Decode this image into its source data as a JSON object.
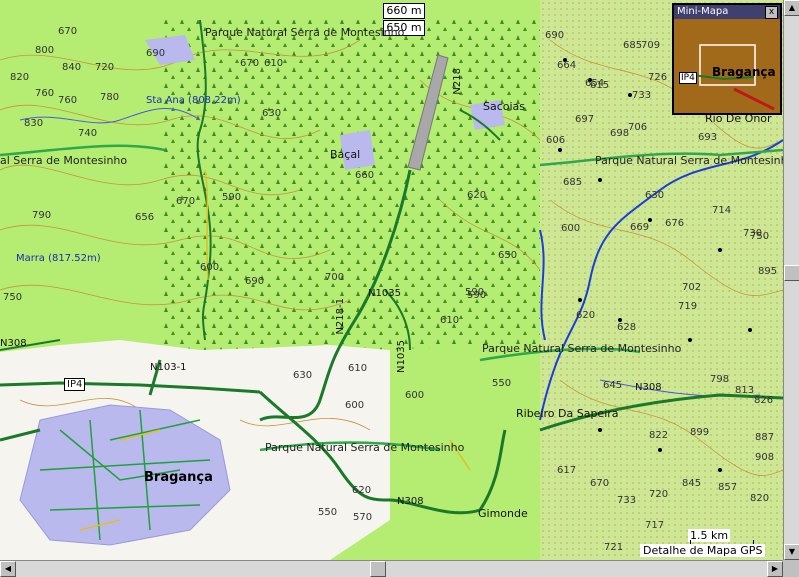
{
  "elevation_legend": [
    "660 m",
    "650 m"
  ],
  "minimap": {
    "title": "Mini-Mapa",
    "close": "x",
    "town": "Bragança",
    "road": "IP4"
  },
  "park_labels": [
    "Parque Natural Serra de Montesinho",
    "al Serra de Montesinho",
    "Parque Natural Serra de Montesinho",
    "Parque Natural Serra de Montesinho",
    "Parque Natural Serra de Montesinho"
  ],
  "peaks": [
    "Sta Ana (808.22m)",
    "Marra (817.52m)"
  ],
  "places": [
    "Baçal",
    "Sacoias",
    "Rio De Onor",
    "Ribeiro Da Sapeira",
    "Gimonde",
    "Bragança"
  ],
  "roads": [
    "N218",
    "N218-1",
    "N1035",
    "N1035",
    "N103-1",
    "N308",
    "N308",
    "N308",
    "IP4"
  ],
  "contours": [
    "670",
    "800",
    "840",
    "820",
    "760",
    "720",
    "780",
    "760",
    "690",
    "670",
    "610",
    "630",
    "740",
    "830",
    "790",
    "656",
    "670",
    "590",
    "600",
    "690",
    "700",
    "660",
    "620",
    "650",
    "590",
    "610",
    "600",
    "550",
    "630",
    "610",
    "600",
    "620",
    "550",
    "570",
    "690",
    "685",
    "709",
    "664",
    "615",
    "654",
    "726",
    "733",
    "697",
    "698",
    "706",
    "606",
    "693",
    "685",
    "600",
    "669",
    "630",
    "714",
    "750",
    "676",
    "730",
    "895",
    "702",
    "719",
    "628",
    "620",
    "645",
    "798",
    "813",
    "826",
    "899",
    "887",
    "822",
    "908",
    "617",
    "845",
    "857",
    "820",
    "670",
    "733",
    "720",
    "717",
    "721",
    "590",
    "750"
  ],
  "scale": "1.5 km",
  "status": "Detalhe de Mapa GPS"
}
